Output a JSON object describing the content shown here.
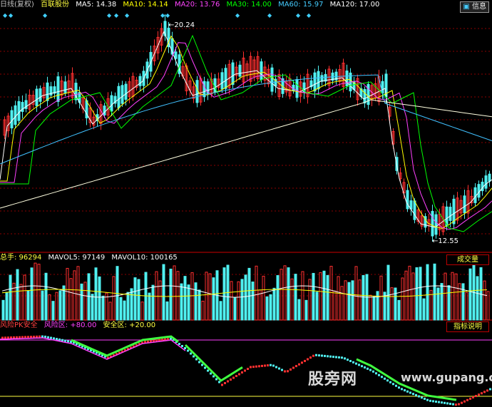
{
  "price_panel": {
    "period_label": "日线(复权)",
    "stock_name": "百联股份",
    "ma": [
      {
        "label": "MA5: 14.38",
        "color": "#ffffff"
      },
      {
        "label": "MA10: 14.14",
        "color": "#ffff00"
      },
      {
        "label": "MA20: 13.76",
        "color": "#ff40ff"
      },
      {
        "label": "MA30: 14.00",
        "color": "#00ff00"
      },
      {
        "label": "MA60: 15.97",
        "color": "#40c0ff"
      },
      {
        "label": "MA120: 17.00",
        "color": "#ffffff"
      }
    ],
    "high_marker": "20.24",
    "low_marker": "12.55",
    "info_button": "信息"
  },
  "volume_panel": {
    "label": "总手: 96294",
    "mavol5": "MAVOL5: 97149",
    "mavol10": "MAVOL10: 100165",
    "tag": "成交量"
  },
  "indicator_panel": {
    "name": "风险PK安全",
    "risk": "风险区: +80.00",
    "safe": "安全区: +20.00",
    "help": "指标说明"
  },
  "watermark": {
    "cn": "股旁网",
    "url": "www.gupang.com"
  },
  "colors": {
    "up": "#ff3030",
    "down": "#50f0f0",
    "grid": "#8b0000"
  }
}
